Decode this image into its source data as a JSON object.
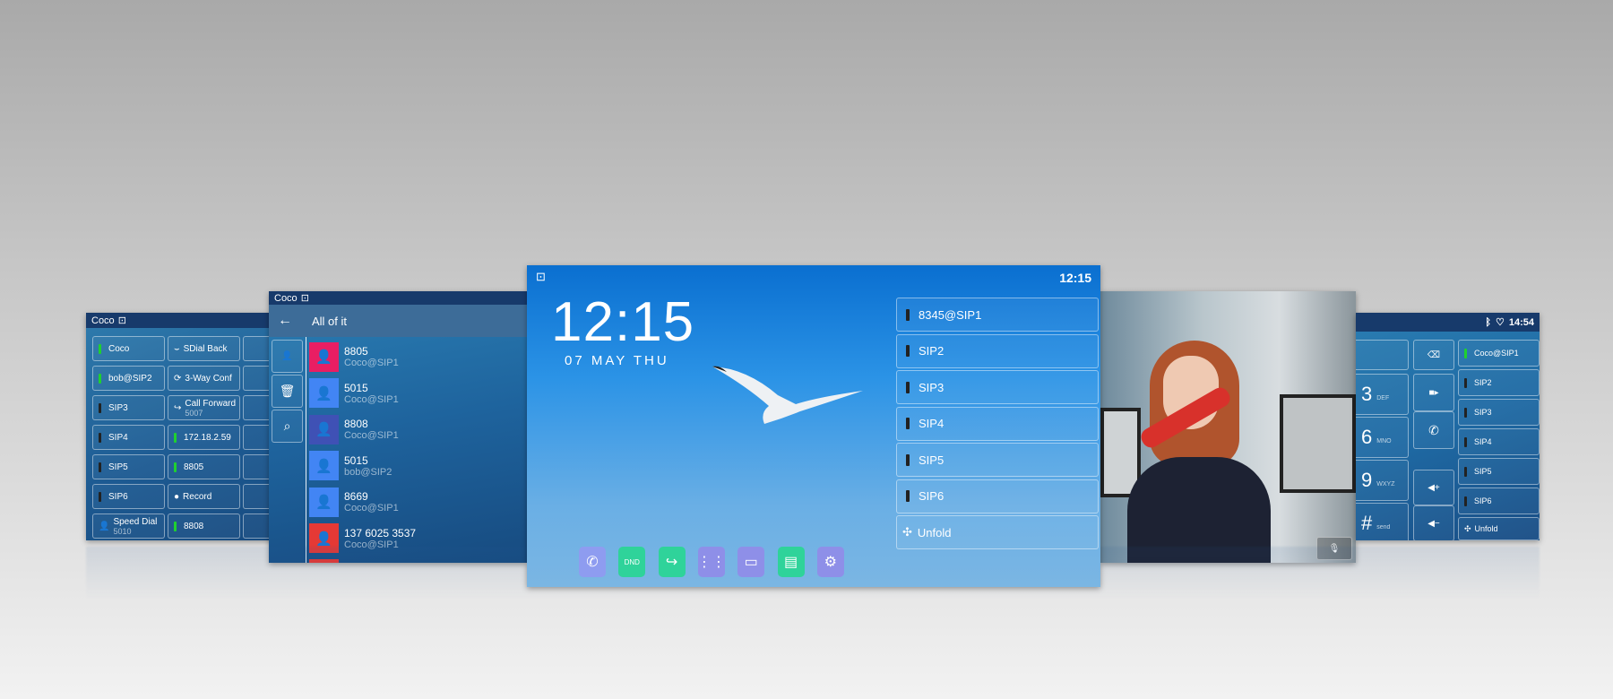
{
  "panel_grid": {
    "user": "Coco",
    "keys": [
      {
        "label": "Coco",
        "led": "on"
      },
      {
        "label": "SDial Back",
        "icon": "sdial-back-icon"
      },
      {
        "label": "bob@SIP2",
        "led": "on"
      },
      {
        "label": "3-Way Conf",
        "icon": "conference-icon"
      },
      {
        "label": "SIP3",
        "led": "off"
      },
      {
        "label": "Call Forward",
        "sub": "5007",
        "icon": "call-forward-icon"
      },
      {
        "label": "SIP4",
        "led": "off"
      },
      {
        "label": "172.18.2.59",
        "led": "on"
      },
      {
        "label": "SIP5",
        "led": "off"
      },
      {
        "label": "8805",
        "led": "on"
      },
      {
        "label": "SIP6",
        "led": "off"
      },
      {
        "label": "Record",
        "icon": "record-icon"
      },
      {
        "label": "Speed Dial",
        "sub": "5010",
        "icon": "person-icon"
      },
      {
        "label": "8808",
        "led": "on"
      }
    ]
  },
  "panel_contacts": {
    "user": "Coco",
    "title": "All of it",
    "contacts": [
      {
        "name": "8805",
        "account": "Coco@SIP1",
        "color": "#e91e63"
      },
      {
        "name": "5015",
        "account": "Coco@SIP1",
        "color": "#4285f4"
      },
      {
        "name": "8808",
        "account": "Coco@SIP1",
        "color": "#3f51b5"
      },
      {
        "name": "5015",
        "account": "bob@SIP2",
        "color": "#4285f4"
      },
      {
        "name": "8669",
        "account": "Coco@SIP1",
        "color": "#4285f4"
      },
      {
        "name": "137 6025 3537",
        "account": "Coco@SIP1",
        "color": "#e53935"
      }
    ]
  },
  "panel_home": {
    "status_time": "12:15",
    "clock": "12:15",
    "date": "07 MAY THU",
    "line_keys": [
      "8345@SIP1",
      "SIP2",
      "SIP3",
      "SIP4",
      "SIP5",
      "SIP6"
    ],
    "unfold": "Unfold",
    "dock": [
      "phone-icon",
      "dnd-icon",
      "call-forward-icon",
      "apps-icon",
      "voicemail-icon",
      "directory-icon",
      "settings-icon"
    ]
  },
  "panel_dialer": {
    "time": "14:54",
    "keys": [
      {
        "digit": "3",
        "letters": "DEF"
      },
      {
        "digit": "6",
        "letters": "MNO"
      },
      {
        "digit": "9",
        "letters": "WXYZ"
      },
      {
        "digit": "#",
        "letters": "send"
      }
    ],
    "line_keys": [
      {
        "label": "Coco@SIP1",
        "led": "on"
      },
      {
        "label": "SIP2",
        "led": "off"
      },
      {
        "label": "SIP3",
        "led": "off"
      },
      {
        "label": "SIP4",
        "led": "off"
      },
      {
        "label": "SIP5",
        "led": "off"
      },
      {
        "label": "SIP6",
        "led": "off"
      }
    ],
    "unfold": "Unfold"
  }
}
